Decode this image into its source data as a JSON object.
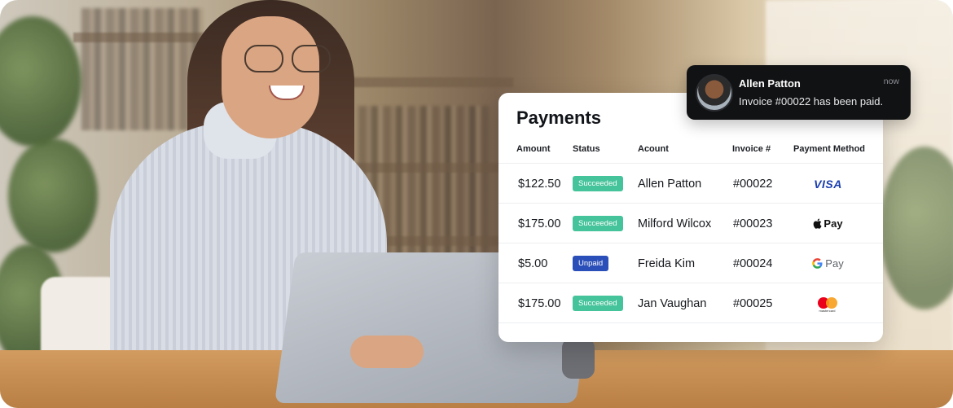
{
  "payments": {
    "title": "Payments",
    "columns": [
      "Amount",
      "Status",
      "Acount",
      "Invoice #",
      "Payment Method"
    ],
    "rows": [
      {
        "amount": "$122.50",
        "status": "Succeeded",
        "status_type": "succeeded",
        "account": "Allen Patton",
        "invoice": "#00022",
        "method": "VISA",
        "method_icon": "visa-icon"
      },
      {
        "amount": "$175.00",
        "status": "Succeeded",
        "status_type": "succeeded",
        "account": "Milford Wilcox",
        "invoice": "#00023",
        "method": "Pay",
        "method_icon": "apple-pay-icon"
      },
      {
        "amount": "$5.00",
        "status": "Unpaid",
        "status_type": "unpaid",
        "account": "Freida Kim",
        "invoice": "#00024",
        "method": "Pay",
        "method_icon": "google-pay-icon"
      },
      {
        "amount": "$175.00",
        "status": "Succeeded",
        "status_type": "succeeded",
        "account": "Jan Vaughan",
        "invoice": "#00025",
        "method": "mastercard",
        "method_icon": "mastercard-icon"
      }
    ]
  },
  "notification": {
    "name": "Allen Patton",
    "message": "Invoice #00022 has been paid.",
    "time": "now"
  },
  "colors": {
    "succeeded": "#45c39a",
    "unpaid": "#2b4fb8",
    "toast_bg": "#111214"
  }
}
